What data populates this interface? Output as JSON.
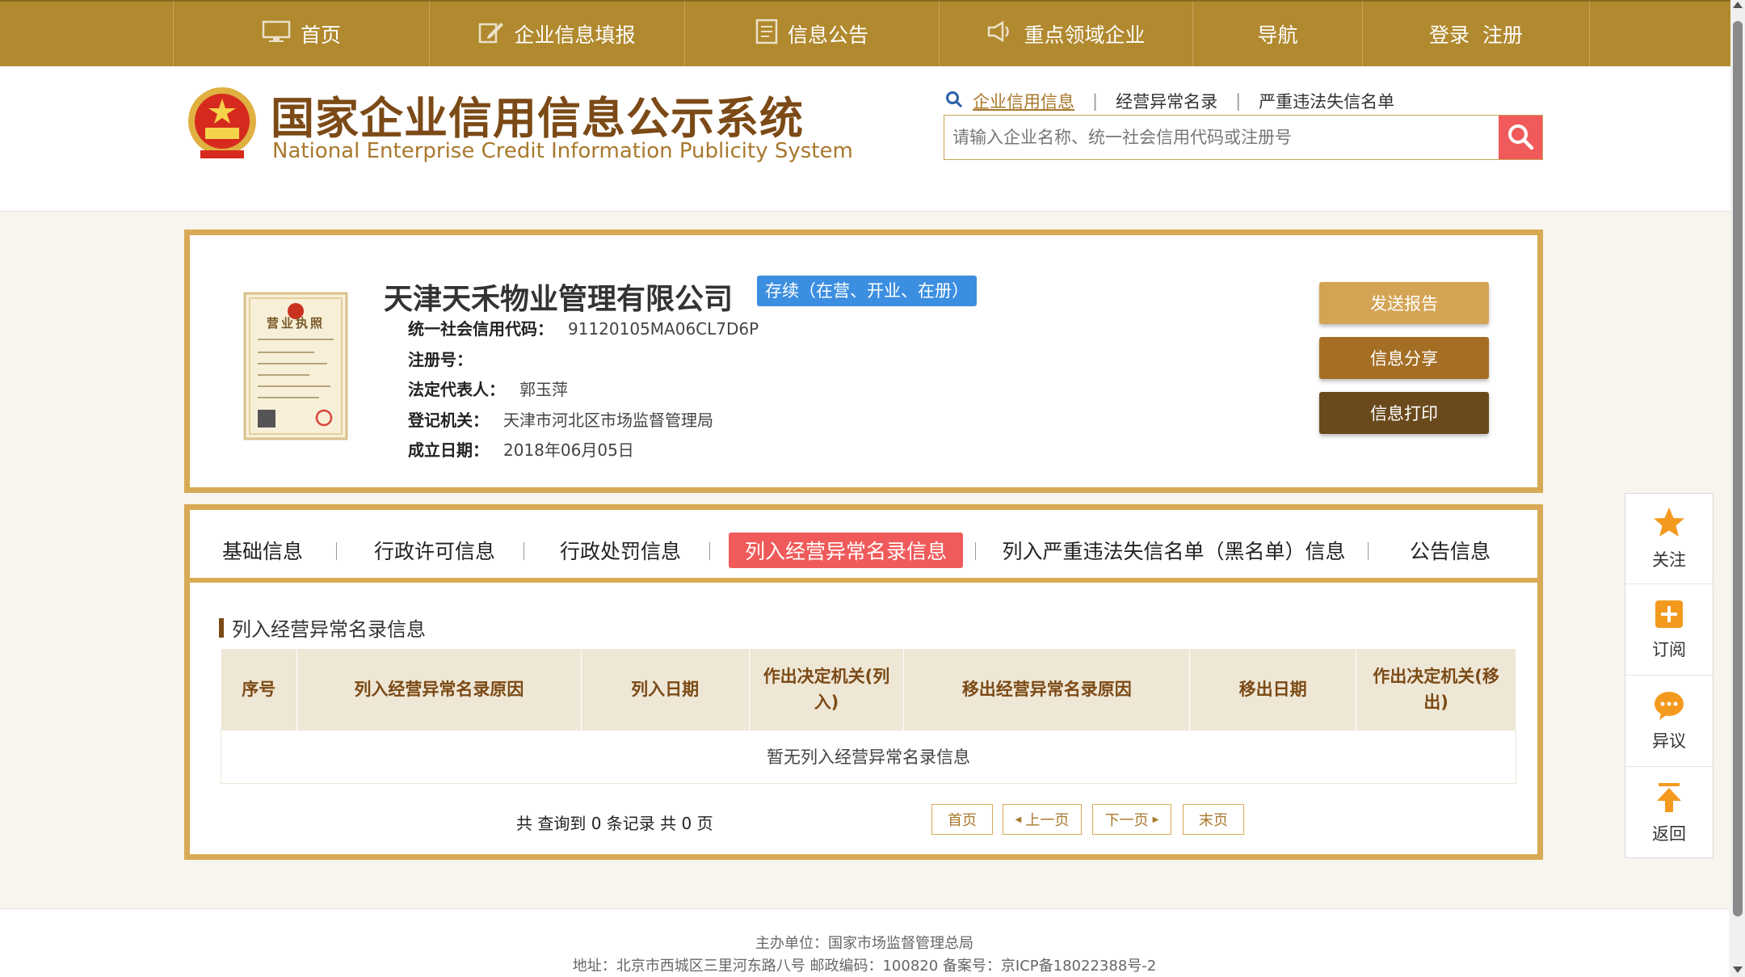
{
  "nav": {
    "items": [
      {
        "label": "首页",
        "icon": "monitor-icon"
      },
      {
        "label": "企业信息填报",
        "icon": "edit-icon"
      },
      {
        "label": "信息公告",
        "icon": "document-icon"
      },
      {
        "label": "重点领域企业",
        "icon": "megaphone-icon"
      },
      {
        "label": "导航"
      },
      {
        "label": "登录  注册"
      }
    ]
  },
  "header": {
    "title": "国家企业信用信息公示系统",
    "subtitle": "National Enterprise Credit Information Publicity System",
    "search_tabs": [
      "企业信用信息",
      "经营异常名录",
      "严重违法失信名单"
    ],
    "search_placeholder": "请输入企业名称、统一社会信用代码或注册号"
  },
  "company": {
    "name": "天津天禾物业管理有限公司",
    "status": "存续（在营、开业、在册）",
    "fields": [
      {
        "label": "统一社会信用代码：",
        "value": "91120105MA06CL7D6P"
      },
      {
        "label": "注册号：",
        "value": ""
      },
      {
        "label": "法定代表人：",
        "value": "郭玉萍"
      },
      {
        "label": "登记机关：",
        "value": "天津市河北区市场监督管理局"
      },
      {
        "label": "成立日期：",
        "value": "2018年06月05日"
      }
    ],
    "license_text": "营业执照",
    "actions": [
      "发送报告",
      "信息分享",
      "信息打印"
    ]
  },
  "tabs": [
    "基础信息",
    "行政许可信息",
    "行政处罚信息",
    "列入经营异常名录信息",
    "列入严重违法失信名单（黑名单）信息",
    "公告信息"
  ],
  "active_tab": "列入经营异常名录信息",
  "section": {
    "title": "列入经营异常名录信息",
    "columns": [
      "序号",
      "列入经营异常名录原因",
      "列入日期",
      "作出决定机关(列入)",
      "移出经营异常名录原因",
      "移出日期",
      "作出决定机关(移出)"
    ],
    "empty_text": "暂无列入经营异常名录信息",
    "record_count": "共 查询到 0 条记录 共 0 页"
  },
  "pager": {
    "first": "首页",
    "prev": "上一页",
    "next": "下一页",
    "last": "末页"
  },
  "side_toolbar": [
    {
      "label": "关注",
      "icon": "star-icon"
    },
    {
      "label": "订阅",
      "icon": "plus-square-icon"
    },
    {
      "label": "异议",
      "icon": "chat-bubble-icon"
    },
    {
      "label": "返回",
      "icon": "arrow-up-icon"
    }
  ],
  "footer": {
    "line1": "主办单位：国家市场监督管理总局",
    "line2": "地址：北京市西城区三里河东路八号   邮政编码：100820   备案号：京ICP备18022388号-2"
  },
  "colors": {
    "gold": "#b1892e",
    "border_gold": "#d8aa55",
    "accent_red": "#f05a5a",
    "status_blue": "#3c8ee0",
    "brown": "#7b4a16"
  }
}
